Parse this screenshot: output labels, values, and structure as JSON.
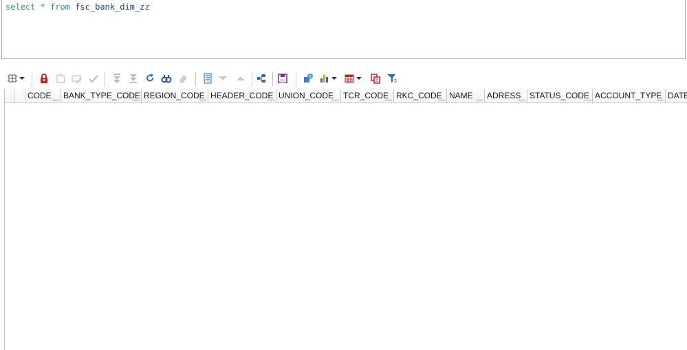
{
  "editor": {
    "sql_select": "select",
    "sql_star": "*",
    "sql_from": "from",
    "sql_table": "fsc_bank_dim_zz"
  },
  "toolbar": {
    "buttons": [
      "grid-options-icon",
      "dropdown-arrow-icon",
      "lock-icon",
      "new-row-icon",
      "edit-row-icon",
      "check-icon",
      "first-record-icon",
      "last-record-icon",
      "refresh-icon",
      "find-icon",
      "clear-icon",
      "single-record-view-icon",
      "next-icon",
      "previous-icon",
      "relations-icon",
      "save-icon",
      "query-info-icon",
      "chart-icon",
      "dropdown-arrow-icon",
      "export-grid-icon",
      "dropdown-arrow-icon",
      "copy-icon",
      "filter-icon"
    ]
  },
  "grid": {
    "columns": [
      "CODE",
      "BANK_TYPE_CODE",
      "REGION_CODE",
      "HEADER_CODE",
      "UNION_CODE",
      "TCR_CODE",
      "RKC_CODE",
      "NAME",
      "ADRESS",
      "STATUS_CODE",
      "ACCOUNT_TYPE",
      "DATE"
    ]
  },
  "colors": {
    "accent_red": "#c0262d",
    "accent_blue": "#2b6cb0",
    "save_purple": "#7a2a8c"
  }
}
